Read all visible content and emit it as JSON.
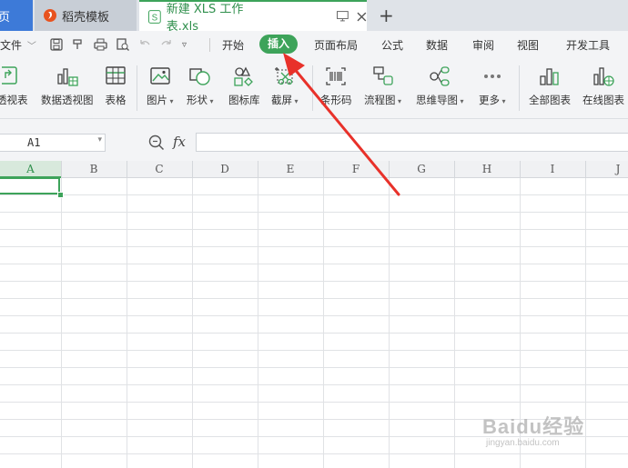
{
  "tabs": {
    "home": "页",
    "daoke": "稻壳模板",
    "doc": "新建 XLS 工作表.xls",
    "add": "+"
  },
  "menu": {
    "file": "文件",
    "items": [
      "开始",
      "插入",
      "页面布局",
      "公式",
      "数据",
      "审阅",
      "视图",
      "开发工具"
    ]
  },
  "ribbon": {
    "pivot_table": "透视表",
    "pivot_chart": "数据透视图",
    "table": "表格",
    "picture": "图片",
    "shape": "形状",
    "icon_lib": "图标库",
    "screenshot": "截屏",
    "barcode": "条形码",
    "flowchart": "流程图",
    "mindmap": "思维导图",
    "more": "更多",
    "all_charts": "全部图表",
    "online_charts": "在线图表"
  },
  "formula": {
    "cell_ref": "A1",
    "fx": "fx"
  },
  "columns": [
    "A",
    "B",
    "C",
    "D",
    "E",
    "F",
    "G",
    "H",
    "I",
    "J"
  ],
  "watermark": {
    "brand": "Baidu经验",
    "url": "jingyan.baidu.com"
  },
  "colors": {
    "accent_green": "#3da35a",
    "home_tab_blue": "#3d7ad8",
    "arrow_red": "#e8312a"
  }
}
